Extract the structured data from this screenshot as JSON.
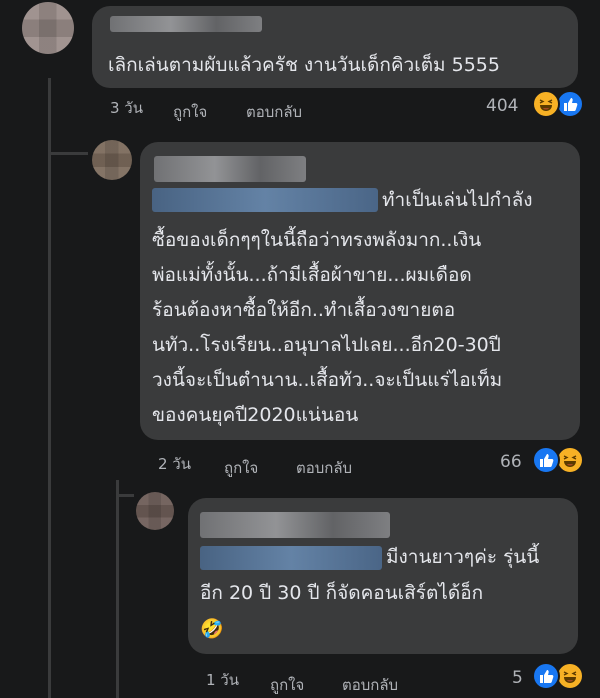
{
  "comments": [
    {
      "text_lines": [
        "เลิกเล่นตามผับแล้วครัช งานวันเด็กคิวเต็ม 5555"
      ],
      "time": "3 วัน",
      "like_label": "ถูกใจ",
      "reply_label": "ตอบกลับ",
      "reaction_count": "404",
      "reactions": [
        "haha-icon",
        "like-icon"
      ]
    },
    {
      "text_lines": [
        "ทำเป็นเล่นไปกำลัง",
        "ซื้อของเด็กๆๆในนี้ถือว่าทรงพลังมาก..เงิน",
        "พ่อแม่ทั้งนั้น...ถ้ามีเสื้อผ้าขาย...ผมเดือด",
        "ร้อนต้องหาซื้อให้อีก..ทำเสื้อวงขายตอ",
        "นทัว..โรงเรียน..อนุบาลไปเลย...อีก20-30ปี",
        "วงนี้จะเป็นตำนาน..เสื้อทัว..จะเป็นแร่ไอเท็ม",
        "ของคนยุคปี2020แน่นอน"
      ],
      "time": "2 วัน",
      "like_label": "ถูกใจ",
      "reply_label": "ตอบกลับ",
      "reaction_count": "66",
      "reactions": [
        "like-icon",
        "haha-icon"
      ]
    },
    {
      "text_lines": [
        "มีงานยาวๆค่ะ รุ่นนี้",
        "อีก 20 ปี 30 ปี ก็จัดคอนเสิร์ตได้อ็ก",
        "🤣"
      ],
      "time": "1 วัน",
      "like_label": "ถูกใจ",
      "reply_label": "ตอบกลับ",
      "reaction_count": "5",
      "reactions": [
        "like-icon",
        "haha-icon"
      ]
    }
  ],
  "colors": {
    "background": "#18191a",
    "bubble": "#3a3b3c",
    "text": "#e4e6eb",
    "meta": "#b0b3b8",
    "like": "#1877f2",
    "haha": "#f7b125"
  }
}
